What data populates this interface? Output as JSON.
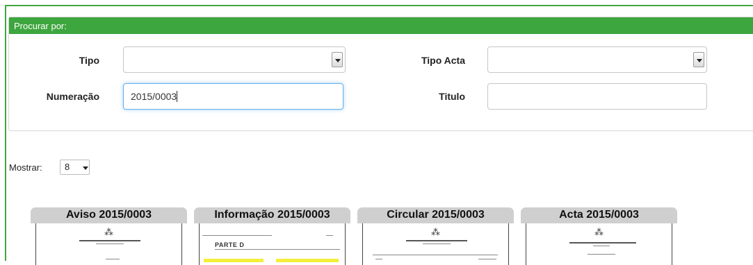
{
  "search": {
    "header": "Procurar por:",
    "tipo_label": "Tipo",
    "tipo_value": "",
    "tipo_acta_label": "Tipo Acta",
    "tipo_acta_value": "",
    "numeracao_label": "Numeração",
    "numeracao_value": "2015/0003",
    "titulo_label": "Titulo",
    "titulo_value": ""
  },
  "mostrar": {
    "label": "Mostrar:",
    "value": "8"
  },
  "documents": [
    {
      "title": "Aviso 2015/0003",
      "preview": "emblem"
    },
    {
      "title": "Informação 2015/0003",
      "preview": "gazette",
      "section": "PARTE D"
    },
    {
      "title": "Circular 2015/0003",
      "preview": "emblem"
    },
    {
      "title": "Acta 2015/0003",
      "preview": "emblem"
    }
  ],
  "colors": {
    "accent": "#3ea63e",
    "tab": "#cfcfcf",
    "focus": "#66afe9",
    "highlight": "#f3ef3a"
  }
}
